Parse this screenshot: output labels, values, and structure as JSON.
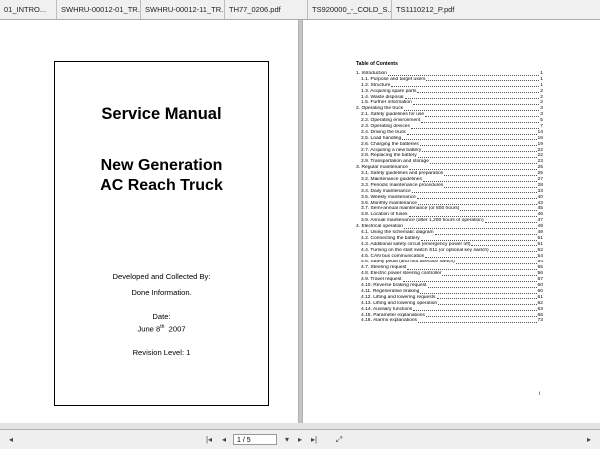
{
  "tabs": [
    {
      "label": "01_INTRO..."
    },
    {
      "label": "SWHRU-00012-01_TR..."
    },
    {
      "label": "SWHRU-00012-11_TR..."
    },
    {
      "label": "TH77_0206.pdf"
    },
    {
      "label": "TS920000_-_COLD_S..."
    },
    {
      "label": "TS1110212_P.pdf"
    }
  ],
  "cover": {
    "title": "Service Manual",
    "subtitle_line1": "New Generation",
    "subtitle_line2": "AC Reach Truck",
    "developed_line1": "Developed and Collected By:",
    "developed_line2": "Done Information.",
    "date_label": "Date:",
    "date_day": "June 8",
    "date_sup": "th",
    "date_year": "2007",
    "revision": "Revision Level: 1"
  },
  "toc": {
    "title": "Table of Contents",
    "page_number": "i",
    "entries": [
      {
        "t": "1. Introduction",
        "p": "1",
        "lvl": 1
      },
      {
        "t": "1.1. Purpose and target users",
        "p": "1",
        "lvl": 2
      },
      {
        "t": "1.2. Structure",
        "p": "1",
        "lvl": 2
      },
      {
        "t": "1.3. Acquiring spare parts",
        "p": "2",
        "lvl": 2
      },
      {
        "t": "1.4. Waste disposal",
        "p": "2",
        "lvl": 2
      },
      {
        "t": "1.5. Further information",
        "p": "2",
        "lvl": 2
      },
      {
        "t": "2. Operating the truck",
        "p": "3",
        "lvl": 1
      },
      {
        "t": "2.1. Safety guidelines for use",
        "p": "3",
        "lvl": 2
      },
      {
        "t": "2.2. Operating environment",
        "p": "5",
        "lvl": 2
      },
      {
        "t": "2.3. Operating devices",
        "p": "7",
        "lvl": 2
      },
      {
        "t": "2.4. Driving the truck",
        "p": "14",
        "lvl": 2
      },
      {
        "t": "2.5. Load handling",
        "p": "16",
        "lvl": 2
      },
      {
        "t": "2.6. Charging the batteries",
        "p": "19",
        "lvl": 2
      },
      {
        "t": "2.7. Acquiring a new battery",
        "p": "22",
        "lvl": 2
      },
      {
        "t": "2.8. Replacing the battery",
        "p": "22",
        "lvl": 2
      },
      {
        "t": "2.9. Transportation and storage",
        "p": "23",
        "lvl": 2
      },
      {
        "t": "3. Regular maintenance",
        "p": "25",
        "lvl": 1
      },
      {
        "t": "3.1. Safety guidelines and preparation",
        "p": "25",
        "lvl": 2
      },
      {
        "t": "3.2. Maintenance guidelines",
        "p": "27",
        "lvl": 2
      },
      {
        "t": "3.3. Periodic maintenance procedures",
        "p": "28",
        "lvl": 2
      },
      {
        "t": "3.4. Daily maintenance",
        "p": "33",
        "lvl": 2
      },
      {
        "t": "3.5. Weekly maintenance",
        "p": "40",
        "lvl": 2
      },
      {
        "t": "3.6. Monthly maintenance",
        "p": "43",
        "lvl": 2
      },
      {
        "t": "3.7. Semi-annual maintenance (or 600 hours)",
        "p": "45",
        "lvl": 2
      },
      {
        "t": "3.8. Location of fuses",
        "p": "46",
        "lvl": 2
      },
      {
        "t": "3.9. Annual maintenance (after 1,200 hours of operation)",
        "p": "47",
        "lvl": 2
      },
      {
        "t": "4. Electrical operation",
        "p": "49",
        "lvl": 1
      },
      {
        "t": "4.1. Using the schematic diagram",
        "p": "49",
        "lvl": 2
      },
      {
        "t": "4.2. Connecting the battery",
        "p": "51",
        "lvl": 2
      },
      {
        "t": "4.3. Additional safety circuit (emergency power off)",
        "p": "51",
        "lvl": 2
      },
      {
        "t": "4.4. Turning on the start switch S11 (or optional key switch)",
        "p": "52",
        "lvl": 2
      },
      {
        "t": "4.5. CAN bus communication",
        "p": "54",
        "lvl": 2
      },
      {
        "t": "4.6. Safety pedal (and foot direction switch)",
        "p": "54",
        "lvl": 2
      },
      {
        "t": "4.7. Steering request",
        "p": "55",
        "lvl": 2
      },
      {
        "t": "4.8. Electric power steering controller",
        "p": "56",
        "lvl": 2
      },
      {
        "t": "4.9. Travel request",
        "p": "57",
        "lvl": 2
      },
      {
        "t": "4.10. Reverse braking request",
        "p": "60",
        "lvl": 2
      },
      {
        "t": "4.11. Regenerative braking",
        "p": "60",
        "lvl": 2
      },
      {
        "t": "4.12. Lifting and lowering requests",
        "p": "61",
        "lvl": 2
      },
      {
        "t": "4.13. Lifting and lowering operation",
        "p": "62",
        "lvl": 2
      },
      {
        "t": "4.14. Auxiliary functions",
        "p": "63",
        "lvl": 2
      },
      {
        "t": "4.15. Parameter explanations",
        "p": "66",
        "lvl": 2
      },
      {
        "t": "4.16. Alarms explanations",
        "p": "73",
        "lvl": 2
      }
    ]
  },
  "statusbar": {
    "page_field": "1 / 5",
    "first_icon": "skip-first-icon",
    "prev_icon": "prev-page-icon",
    "next_icon": "next-page-icon",
    "last_icon": "skip-last-icon"
  }
}
